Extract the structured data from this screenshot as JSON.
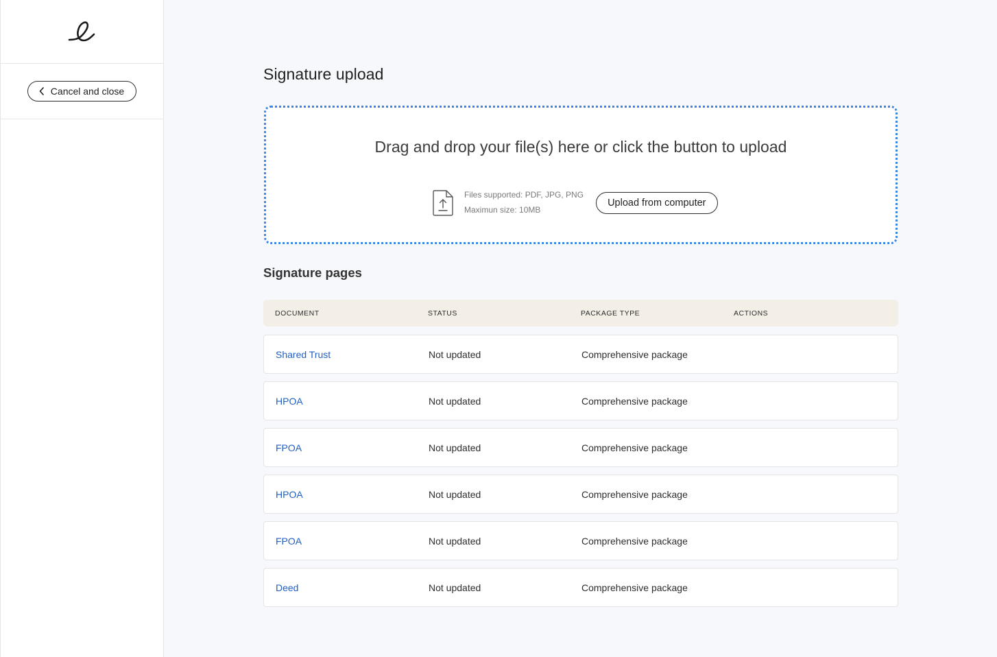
{
  "sidebar": {
    "cancel_label": "Cancel and close"
  },
  "main": {
    "title": "Signature upload",
    "dropzone": {
      "prompt": "Drag and drop your file(s) here or click the button to upload",
      "files_supported": "Files supported: PDF, JPG, PNG",
      "max_size": "Maximun size: 10MB",
      "upload_label": "Upload from computer"
    },
    "section_title": "Signature pages",
    "table": {
      "headers": [
        "DOCUMENT",
        "STATUS",
        "PACKAGE TYPE",
        "ACTIONS"
      ],
      "rows": [
        {
          "document": "Shared Trust",
          "status": "Not updated",
          "package": "Comprehensive package"
        },
        {
          "document": "HPOA",
          "status": "Not updated",
          "package": "Comprehensive package"
        },
        {
          "document": "FPOA",
          "status": "Not updated",
          "package": "Comprehensive package"
        },
        {
          "document": "HPOA",
          "status": "Not updated",
          "package": "Comprehensive package"
        },
        {
          "document": "FPOA",
          "status": "Not updated",
          "package": "Comprehensive package"
        },
        {
          "document": "Deed",
          "status": "Not updated",
          "package": "Comprehensive package"
        }
      ]
    }
  },
  "colors": {
    "accent_link": "#1f5fc4",
    "dropzone_border": "#3a86e6",
    "table_header_bg": "#f3efe6"
  },
  "icons": {
    "logo": "script-e-logo",
    "back": "chevron-left-icon",
    "file_upload": "file-upload-icon"
  }
}
